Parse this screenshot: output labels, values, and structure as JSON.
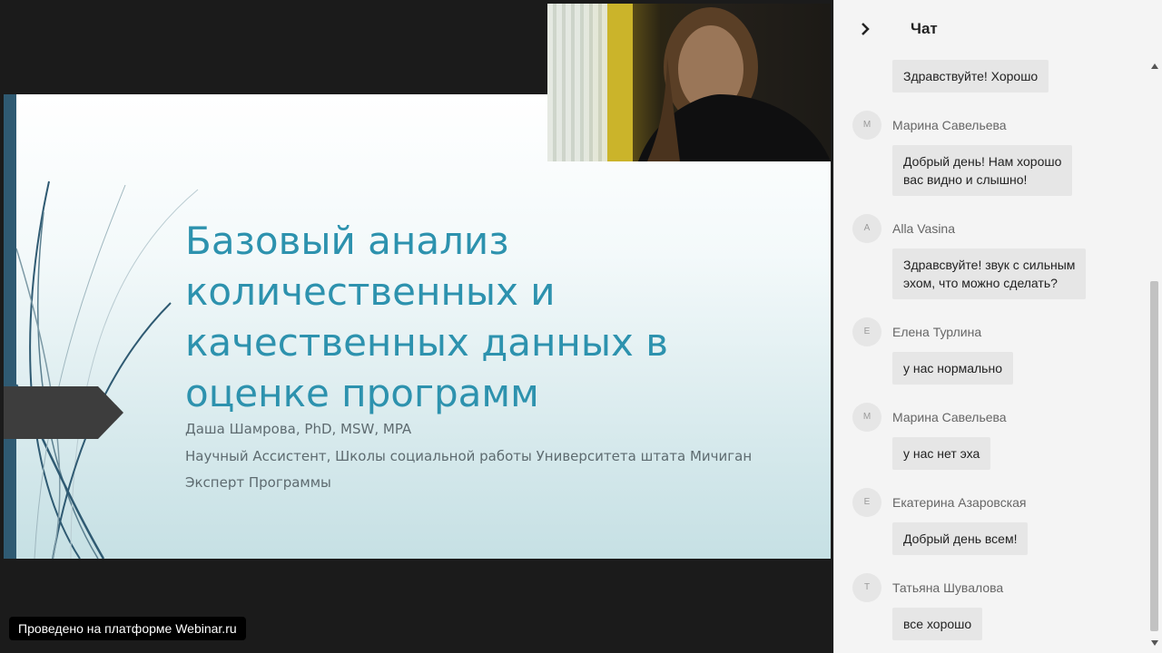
{
  "slide": {
    "title": "Базовый анализ количественных и качественных данных в оценке программ",
    "author": "Даша Шамрова, PhD, MSW, MPA",
    "position": "Научный Ассистент, Школы социальной работы Университета штата Мичиган",
    "role": "Эксперт Программы"
  },
  "badge": "Проведено на платформе Webinar.ru",
  "chat": {
    "title": "Чат",
    "partial_message": "Здравствуйте! Хорошо",
    "messages": [
      {
        "initial": "М",
        "author": "Марина Савельева",
        "lines": [
          "Добрый день! Нам хорошо",
          "вас видно и слышно!"
        ]
      },
      {
        "initial": "A",
        "author": "Alla Vasina",
        "lines": [
          "Здравсвуйте! звук с сильным",
          "эхом, что можно сделать?"
        ]
      },
      {
        "initial": "Е",
        "author": "Елена Турлина",
        "lines": [
          "у нас нормально"
        ]
      },
      {
        "initial": "М",
        "author": "Марина Савельева",
        "lines": [
          "у нас нет эха"
        ]
      },
      {
        "initial": "Е",
        "author": "Екатерина Азаровская",
        "lines": [
          "Добрый день всем!"
        ]
      },
      {
        "initial": "Т",
        "author": "Татьяна Шувалова",
        "lines": [
          "все хорошо"
        ]
      }
    ]
  },
  "colors": {
    "slide_title": "#2d92ae",
    "slide_bar": "#2f5a72",
    "chat_bg": "#f4f4f4",
    "bubble_bg": "#e6e6e6"
  }
}
